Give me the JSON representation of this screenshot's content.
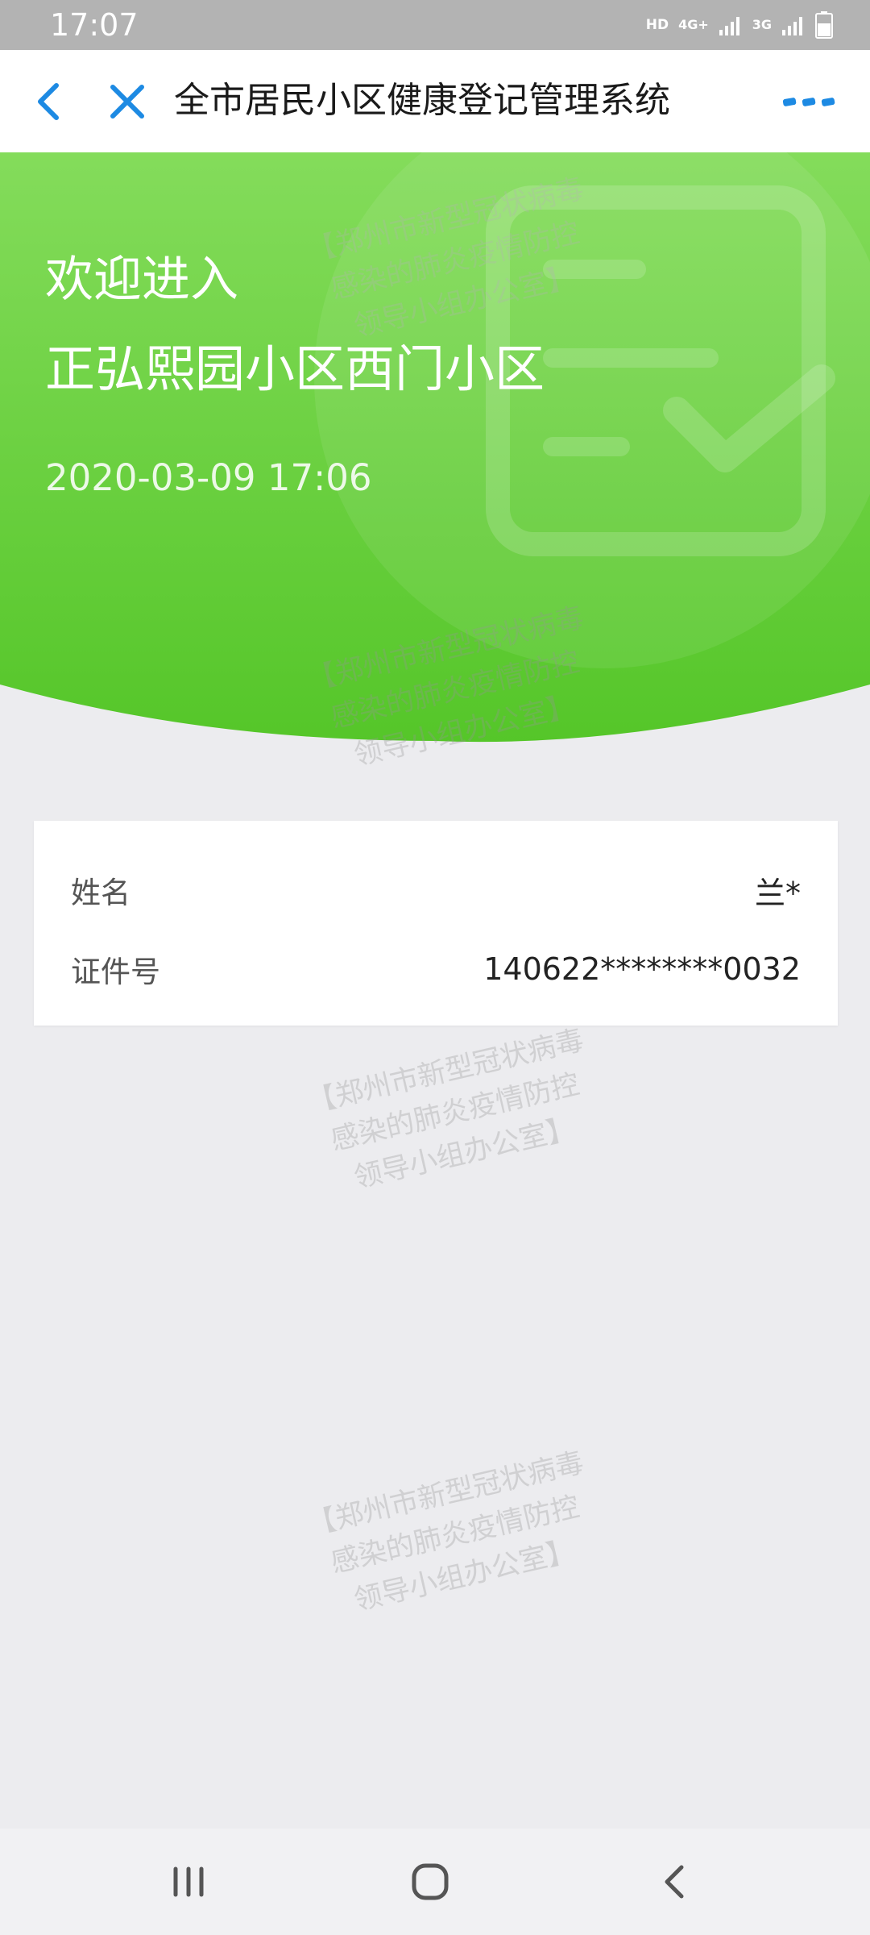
{
  "status_bar": {
    "time": "17:07",
    "hd": "HD",
    "network_1": "4G+",
    "network_2": "3G",
    "icons": [
      "signal-icon",
      "signal-icon",
      "battery-icon"
    ]
  },
  "title_bar": {
    "title": "全市居民小区健康登记管理系统",
    "icons": [
      "back-icon",
      "close-icon",
      "more-icon"
    ]
  },
  "hero": {
    "welcome": "欢迎进入",
    "community": "正弘熙园小区西门小区",
    "datetime": "2020-03-09 17:06",
    "background_icon": "checklist-icon"
  },
  "info": {
    "rows": [
      {
        "label": "姓名",
        "value": "兰*"
      },
      {
        "label": "证件号",
        "value": "140622********0032"
      }
    ]
  },
  "watermark": {
    "lines": [
      "【郑州市新型冠状病毒",
      "感染的肺炎疫情防控",
      "领导小组办公室】"
    ]
  },
  "bottom_nav": {
    "icons": [
      "recent-apps-icon",
      "home-icon",
      "back-icon"
    ]
  },
  "colors": {
    "accent_blue": "#1d8ae3",
    "green_top": "#84dc5b",
    "green_bottom": "#55c629",
    "background": "#ececef"
  }
}
